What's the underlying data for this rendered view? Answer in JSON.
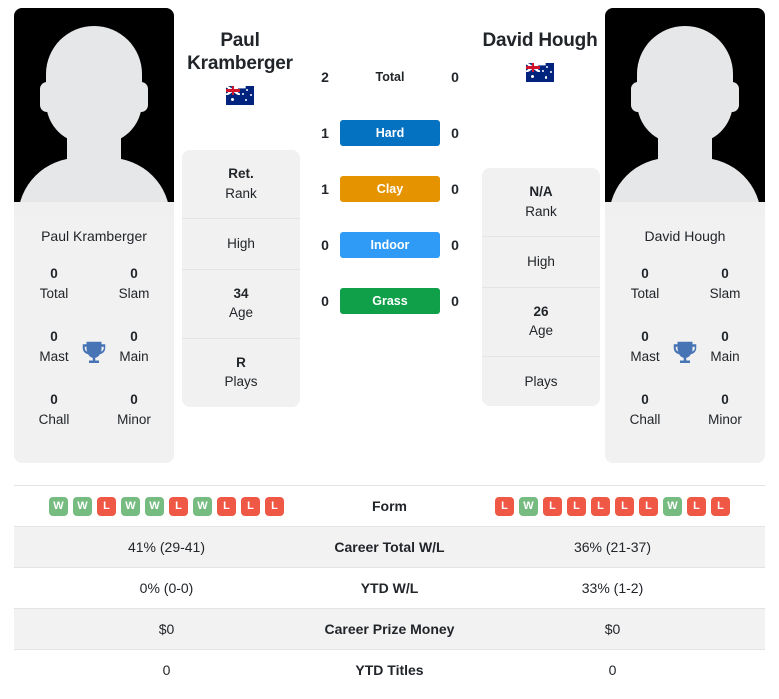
{
  "colors": {
    "hard": "#0571c1",
    "clay": "#e59400",
    "indoor": "#2f9bf7",
    "grass": "#10a04a",
    "win": "#76bb7f",
    "loss": "#ef5845",
    "trophy": "#4674b5",
    "card_bg": "#f1f1f1"
  },
  "players": {
    "left": {
      "name": "Paul Kramberger",
      "name_line1": "Paul",
      "name_line2": "Kramberger",
      "flag": "australia-flag",
      "photo": "player-photo-placeholder",
      "titles": [
        {
          "num": "0",
          "label": "Total"
        },
        {
          "num": "0",
          "label": "Slam"
        },
        {
          "num": "0",
          "label": "Mast"
        },
        {
          "num": "0",
          "label": "Main"
        },
        {
          "num": "0",
          "label": "Chall"
        },
        {
          "num": "0",
          "label": "Minor"
        }
      ],
      "info": [
        {
          "value": "Ret.",
          "label": "Rank"
        },
        {
          "value": "",
          "label": "High"
        },
        {
          "value": "34",
          "label": "Age"
        },
        {
          "value": "R",
          "label": "Plays"
        }
      ],
      "form": [
        "W",
        "W",
        "L",
        "W",
        "W",
        "L",
        "W",
        "L",
        "L",
        "L"
      ],
      "career_total_wl": "41% (29-41)",
      "ytd_wl": "0% (0-0)",
      "career_prize_money": "$0",
      "ytd_titles": "0"
    },
    "right": {
      "name": "David Hough",
      "name_line1": "David Hough",
      "name_line2": "",
      "flag": "australia-flag",
      "photo": "player-photo-placeholder",
      "titles": [
        {
          "num": "0",
          "label": "Total"
        },
        {
          "num": "0",
          "label": "Slam"
        },
        {
          "num": "0",
          "label": "Mast"
        },
        {
          "num": "0",
          "label": "Main"
        },
        {
          "num": "0",
          "label": "Chall"
        },
        {
          "num": "0",
          "label": "Minor"
        }
      ],
      "info": [
        {
          "value": "N/A",
          "label": "Rank"
        },
        {
          "value": "",
          "label": "High"
        },
        {
          "value": "26",
          "label": "Age"
        },
        {
          "value": "",
          "label": "Plays"
        }
      ],
      "form": [
        "L",
        "W",
        "L",
        "L",
        "L",
        "L",
        "L",
        "W",
        "L",
        "L"
      ],
      "career_total_wl": "36% (21-37)",
      "ytd_wl": "33% (1-2)",
      "career_prize_money": "$0",
      "ytd_titles": "0"
    }
  },
  "head_to_head": {
    "total": {
      "label": "Total",
      "left": "2",
      "right": "0"
    },
    "surfaces": [
      {
        "label": "Hard",
        "left": "1",
        "right": "0",
        "color": "#0571c1"
      },
      {
        "label": "Clay",
        "left": "1",
        "right": "0",
        "color": "#e59400"
      },
      {
        "label": "Indoor",
        "left": "0",
        "right": "0",
        "color": "#2f9bf7"
      },
      {
        "label": "Grass",
        "left": "0",
        "right": "0",
        "color": "#10a04a"
      }
    ]
  },
  "table": {
    "rows": [
      {
        "label": "Form",
        "type": "form"
      },
      {
        "label": "Career Total W/L",
        "type": "text",
        "left": "41% (29-41)",
        "right": "36% (21-37)"
      },
      {
        "label": "YTD W/L",
        "type": "text",
        "left": "0% (0-0)",
        "right": "33% (1-2)"
      },
      {
        "label": "Career Prize Money",
        "type": "text",
        "left": "$0",
        "right": "$0"
      },
      {
        "label": "YTD Titles",
        "type": "text",
        "left": "0",
        "right": "0"
      }
    ]
  }
}
